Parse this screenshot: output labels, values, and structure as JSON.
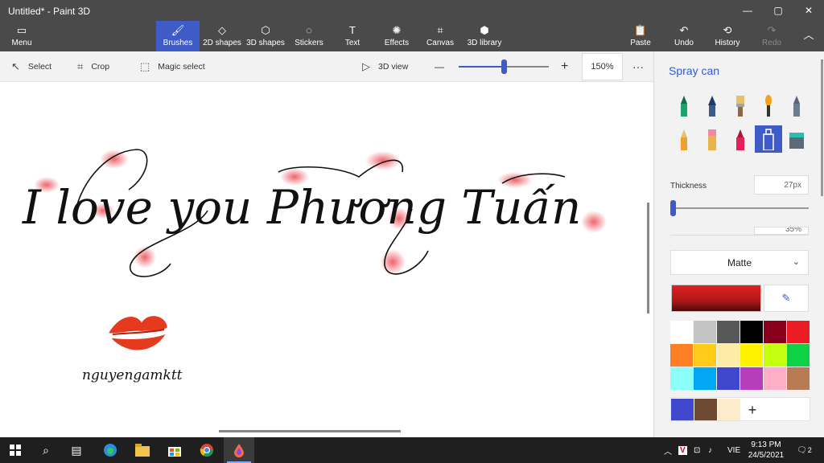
{
  "window": {
    "title": "Untitled* - Paint 3D"
  },
  "window_controls": {
    "minimize": "—",
    "maximize": "▢",
    "close": "✕"
  },
  "ribbon": {
    "menu_label": "Menu",
    "tools": [
      {
        "label": "Brushes",
        "icon": "brush-icon"
      },
      {
        "label": "2D shapes",
        "icon": "2d-shapes-icon"
      },
      {
        "label": "3D shapes",
        "icon": "3d-shapes-icon"
      },
      {
        "label": "Stickers",
        "icon": "stickers-icon"
      },
      {
        "label": "Text",
        "icon": "text-icon"
      },
      {
        "label": "Effects",
        "icon": "effects-icon"
      },
      {
        "label": "Canvas",
        "icon": "canvas-icon"
      },
      {
        "label": "3D library",
        "icon": "3d-library-icon"
      }
    ],
    "paste_label": "Paste",
    "undo_label": "Undo",
    "history_label": "History",
    "redo_label": "Redo"
  },
  "toolbar": {
    "select_label": "Select",
    "crop_label": "Crop",
    "magic_select_label": "Magic select",
    "view3d_label": "3D view",
    "zoom_minus": "—",
    "zoom_plus": "+",
    "zoom_level": "150%",
    "zoom_fraction": 0.5,
    "more": "···"
  },
  "canvas": {
    "handwriting": "I love you Phương Tuấn",
    "signature": "nguyengamktt"
  },
  "panel": {
    "title": "Spray can",
    "thickness_label": "Thickness",
    "thickness_value": "27px",
    "opacity_value": "35%",
    "finish_label": "Matte",
    "brushes": [
      "marker",
      "calligraphy-pen",
      "oil-brush",
      "watercolor",
      "pencil",
      "crayon-pencil",
      "eraser",
      "pixel-pen",
      "spray-can",
      "fill"
    ],
    "current_color": "#e02020",
    "palette": [
      "#ffffff",
      "#c3c3c3",
      "#585858",
      "#000000",
      "#88001b",
      "#ec1c24",
      "#ff7f27",
      "#ffca18",
      "#fdeca6",
      "#fff200",
      "#c4ff0e",
      "#0ed145",
      "#8cfffb",
      "#00a8f3",
      "#3f48cc",
      "#b83dba",
      "#ffaec8",
      "#b97a56"
    ],
    "custom_colors": [
      "#3f48cc",
      "#6e4a32",
      "#fdeccb"
    ],
    "add_color": "+"
  },
  "taskbar": {
    "items": [
      "windows-icon",
      "search-icon",
      "task-view-icon",
      "edge-icon",
      "file-explorer-icon",
      "store-icon",
      "chrome-icon",
      "paint3d-icon"
    ],
    "language": "VIE",
    "time": "9:13 PM",
    "date": "24/5/2021",
    "notifications": "2"
  }
}
